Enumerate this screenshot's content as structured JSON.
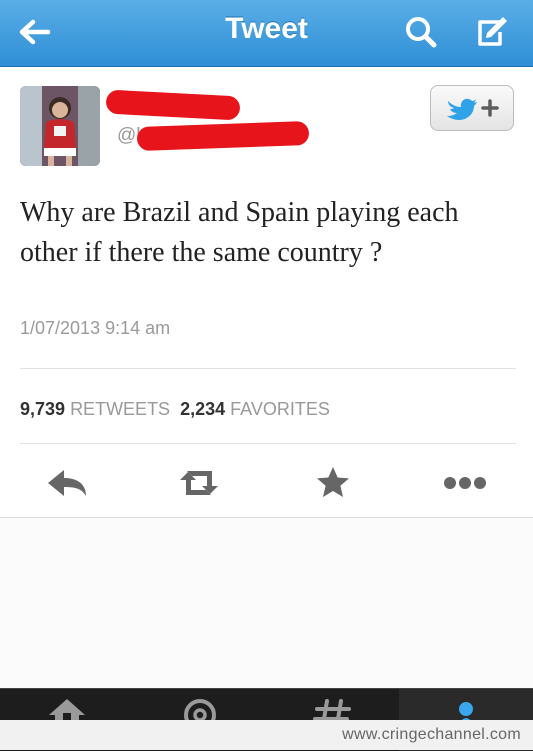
{
  "nav": {
    "title": "Tweet",
    "icons": [
      "back-arrow-icon",
      "search-icon",
      "compose-icon"
    ]
  },
  "tweet": {
    "handle_prefix": "@l",
    "text": "Why are Brazil and Spain playing each other if there the same country ?",
    "timestamp": "1/07/2013 9:14 am",
    "retweets_count": "9,739",
    "retweets_label": "RETWEETS",
    "favorites_count": "2,234",
    "favorites_label": "FAVORITES"
  },
  "actions": [
    "reply-icon",
    "retweet-icon",
    "favorite-icon",
    "more-icon"
  ],
  "tabs": [
    "home-icon",
    "connect-icon",
    "discover-icon",
    "me-icon"
  ],
  "watermark": "www.cringechannel.com",
  "colors": {
    "nav_blue": "#2f8fd6",
    "redaction_red": "#e8141b",
    "twitter_blue": "#2fa2e8"
  }
}
